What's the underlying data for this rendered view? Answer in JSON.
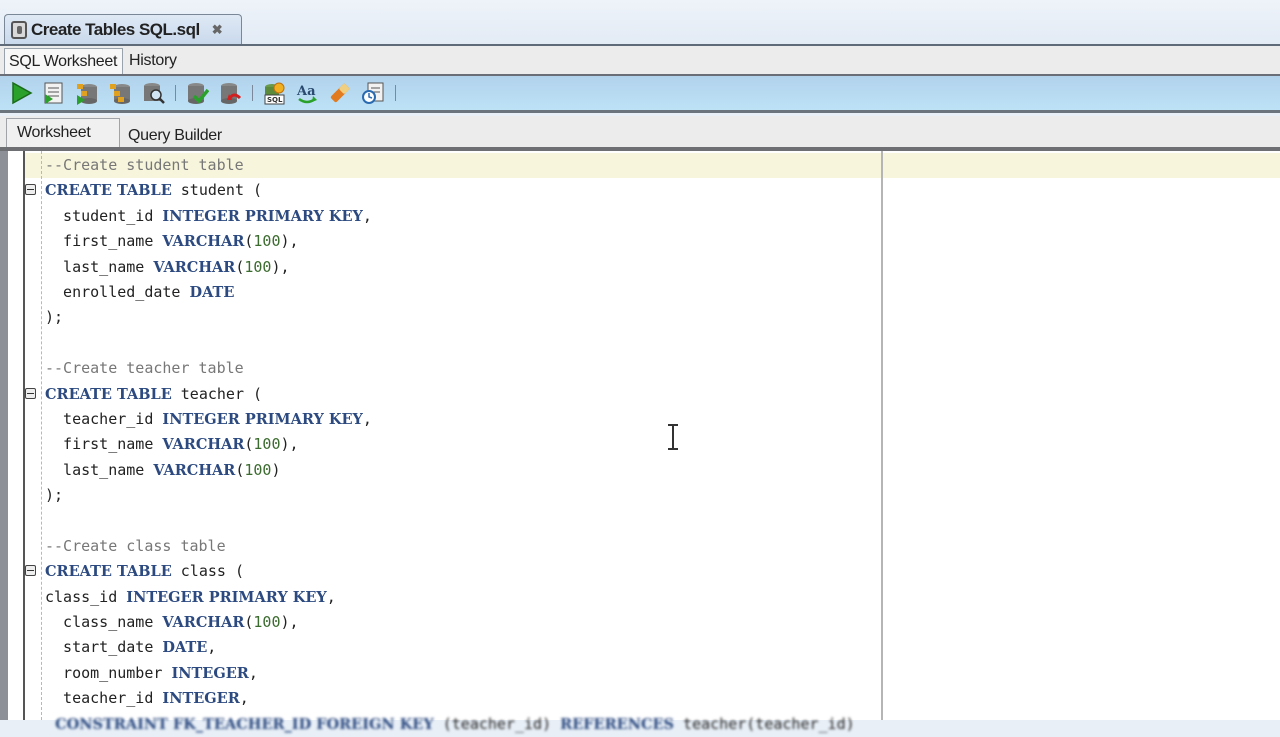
{
  "file_tab": {
    "title": "Create Tables SQL.sql",
    "close_icon": "close-icon"
  },
  "subtabs": [
    {
      "label": "SQL Worksheet",
      "active": true
    },
    {
      "label": "History",
      "active": false
    }
  ],
  "toolbar": {
    "buttons": [
      {
        "name": "run-statement",
        "icon": "play-icon"
      },
      {
        "name": "run-script",
        "icon": "script-icon"
      },
      {
        "name": "autotrace",
        "icon": "autotrace-icon"
      },
      {
        "name": "explain-plan",
        "icon": "explain-plan-icon"
      },
      {
        "name": "sql-tuning-advisor",
        "icon": "tuning-icon"
      },
      {
        "name": "commit",
        "icon": "commit-icon"
      },
      {
        "name": "rollback",
        "icon": "rollback-icon"
      },
      {
        "name": "unshared-sql-worksheet",
        "icon": "sql-worksheet-icon"
      },
      {
        "name": "to-upper-lower",
        "icon": "case-icon"
      },
      {
        "name": "clear",
        "icon": "eraser-icon"
      },
      {
        "name": "sql-history",
        "icon": "history-icon"
      }
    ]
  },
  "worksheet_tabs": [
    {
      "label": "Worksheet",
      "active": true
    },
    {
      "label": "Query Builder",
      "active": false
    }
  ],
  "editor": {
    "lines": [
      {
        "fold": false,
        "tokens": [
          {
            "t": "--Create student table",
            "c": "cm"
          }
        ]
      },
      {
        "fold": true,
        "tokens": [
          {
            "t": "CREATE TABLE",
            "c": "kw"
          },
          {
            "t": " student (",
            "c": ""
          }
        ]
      },
      {
        "fold": false,
        "tokens": [
          {
            "t": "  student_id ",
            "c": ""
          },
          {
            "t": "INTEGER PRIMARY KEY",
            "c": "kw"
          },
          {
            "t": ",",
            "c": ""
          }
        ]
      },
      {
        "fold": false,
        "tokens": [
          {
            "t": "  first_name ",
            "c": ""
          },
          {
            "t": "VARCHAR",
            "c": "kw"
          },
          {
            "t": "(",
            "c": ""
          },
          {
            "t": "100",
            "c": "num"
          },
          {
            "t": "),",
            "c": ""
          }
        ]
      },
      {
        "fold": false,
        "tokens": [
          {
            "t": "  last_name ",
            "c": ""
          },
          {
            "t": "VARCHAR",
            "c": "kw"
          },
          {
            "t": "(",
            "c": ""
          },
          {
            "t": "100",
            "c": "num"
          },
          {
            "t": "),",
            "c": ""
          }
        ]
      },
      {
        "fold": false,
        "tokens": [
          {
            "t": "  enrolled_date ",
            "c": ""
          },
          {
            "t": "DATE",
            "c": "kw"
          }
        ]
      },
      {
        "fold": false,
        "tokens": [
          {
            "t": ");",
            "c": ""
          }
        ]
      },
      {
        "fold": false,
        "tokens": [
          {
            "t": "",
            "c": ""
          }
        ]
      },
      {
        "fold": false,
        "tokens": [
          {
            "t": "--Create teacher table",
            "c": "cm"
          }
        ]
      },
      {
        "fold": true,
        "tokens": [
          {
            "t": "CREATE TABLE",
            "c": "kw"
          },
          {
            "t": " teacher (",
            "c": ""
          }
        ]
      },
      {
        "fold": false,
        "tokens": [
          {
            "t": "  teacher_id ",
            "c": ""
          },
          {
            "t": "INTEGER PRIMARY KEY",
            "c": "kw"
          },
          {
            "t": ",",
            "c": ""
          }
        ]
      },
      {
        "fold": false,
        "tokens": [
          {
            "t": "  first_name ",
            "c": ""
          },
          {
            "t": "VARCHAR",
            "c": "kw"
          },
          {
            "t": "(",
            "c": ""
          },
          {
            "t": "100",
            "c": "num"
          },
          {
            "t": "),",
            "c": ""
          }
        ]
      },
      {
        "fold": false,
        "tokens": [
          {
            "t": "  last_name ",
            "c": ""
          },
          {
            "t": "VARCHAR",
            "c": "kw"
          },
          {
            "t": "(",
            "c": ""
          },
          {
            "t": "100",
            "c": "num"
          },
          {
            "t": ")",
            "c": ""
          }
        ]
      },
      {
        "fold": false,
        "tokens": [
          {
            "t": ");",
            "c": ""
          }
        ]
      },
      {
        "fold": false,
        "tokens": [
          {
            "t": "",
            "c": ""
          }
        ]
      },
      {
        "fold": false,
        "tokens": [
          {
            "t": "--Create class table",
            "c": "cm"
          }
        ]
      },
      {
        "fold": true,
        "tokens": [
          {
            "t": "CREATE TABLE",
            "c": "kw"
          },
          {
            "t": " class (",
            "c": ""
          }
        ]
      },
      {
        "fold": false,
        "tokens": [
          {
            "t": "class_id ",
            "c": ""
          },
          {
            "t": "INTEGER PRIMARY KEY",
            "c": "kw"
          },
          {
            "t": ",",
            "c": ""
          }
        ]
      },
      {
        "fold": false,
        "tokens": [
          {
            "t": "  class_name ",
            "c": ""
          },
          {
            "t": "VARCHAR",
            "c": "kw"
          },
          {
            "t": "(",
            "c": ""
          },
          {
            "t": "100",
            "c": "num"
          },
          {
            "t": "),",
            "c": ""
          }
        ]
      },
      {
        "fold": false,
        "tokens": [
          {
            "t": "  start_date ",
            "c": ""
          },
          {
            "t": "DATE",
            "c": "kw"
          },
          {
            "t": ",",
            "c": ""
          }
        ]
      },
      {
        "fold": false,
        "tokens": [
          {
            "t": "  room_number ",
            "c": ""
          },
          {
            "t": "INTEGER",
            "c": "kw"
          },
          {
            "t": ",",
            "c": ""
          }
        ]
      },
      {
        "fold": false,
        "tokens": [
          {
            "t": "  teacher_id ",
            "c": ""
          },
          {
            "t": "INTEGER",
            "c": "kw"
          },
          {
            "t": ",",
            "c": ""
          }
        ]
      },
      {
        "fold": false,
        "partial": true,
        "tokens": [
          {
            "t": "  CONSTRAINT FK_TEACHER_ID FOREIGN KEY",
            "c": "kw"
          },
          {
            "t": " (teacher_id) ",
            "c": ""
          },
          {
            "t": "REFERENCES",
            "c": "kw"
          },
          {
            "t": " teacher(teacher_id)",
            "c": ""
          }
        ]
      }
    ]
  }
}
